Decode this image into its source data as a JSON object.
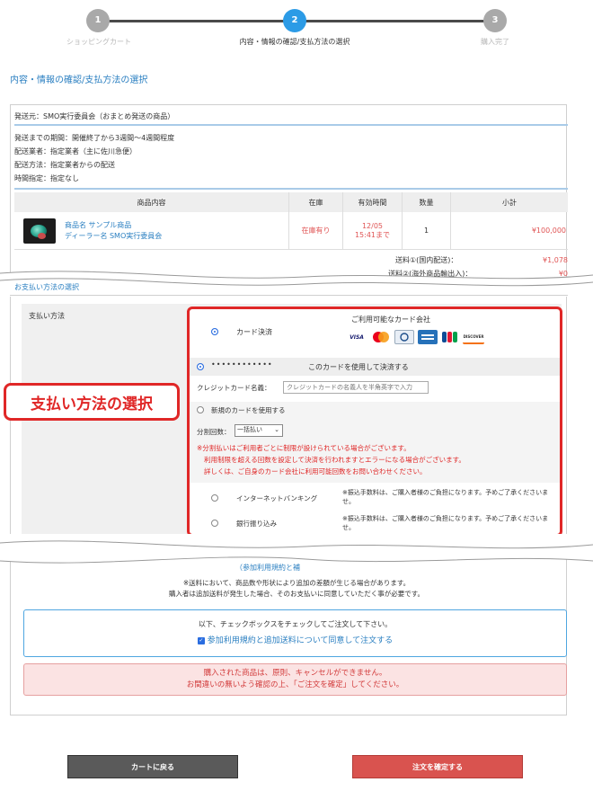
{
  "stepper": {
    "steps": [
      {
        "number": "1",
        "label": "ショッピングカート"
      },
      {
        "number": "2",
        "label": "内容・情報の確認/支払方法の選択"
      },
      {
        "number": "3",
        "label": "購入完了"
      }
    ]
  },
  "page_heading": "内容・情報の確認/支払方法の選択",
  "shipping": {
    "from": "発送元：SMO実行委員会（おまとめ発送の商品）",
    "lines": [
      "発送までの期間：開催終了から3週間〜4週間程度",
      "配送業者：指定業者（主に佐川急便）",
      "配送方法：指定業者からの配送",
      "時間指定：指定なし"
    ]
  },
  "order_table": {
    "headers": [
      "商品内容",
      "在庫",
      "有効時間",
      "数量",
      "小計"
    ],
    "rows": [
      {
        "product_name": "商品名 サンプル商品",
        "dealer_name": "ディーラー名 SMO実行委員会",
        "stock": "在庫有り",
        "valid_date": "12/05",
        "valid_time": "15:41まで",
        "quantity": "1",
        "subtotal": "¥100,000"
      }
    ]
  },
  "shipping_fees": [
    {
      "label": "送料①(国内配送)：",
      "value": "¥1,078"
    },
    {
      "label": "送料②(海外商品輸出入)：",
      "value": "¥0"
    }
  ],
  "payment": {
    "heading": "お支払い方法の選択",
    "label": "支払い方法",
    "card_option": "カード決済",
    "available_cards_title": "ご利用可能なカード会社",
    "card_logos": [
      "VISA",
      "Mastercard",
      "Diners",
      "AMEX",
      "JCB",
      "DISCOVER"
    ],
    "saved_card_number": "••••••••••••",
    "use_saved_card": "このカードを使用して決済する",
    "holder_label": "クレジットカード名義：",
    "holder_placeholder": "クレジットカードの名義人を半角英字で入力",
    "new_card": "新規のカードを使用する",
    "installment_label": "分割回数：",
    "installment_value": "一括払い",
    "installment_notes": [
      "※分割払いはご利用者ごとに制限が設けられている場合がございます。",
      "利用制限を超える回数を設定して決済を行われますとエラーになる場合がございます。",
      "詳しくは、ご自身のカード会社に利用可能回数をお問い合わせください。"
    ],
    "net_banking": "インターネットバンキング",
    "net_banking_note": "※振込手数料は、ご購入者様のご負担になります。予めご了承くださいませ。",
    "bank_transfer": "銀行振り込み",
    "bank_transfer_note": "※振込手数料は、ご購入者様のご負担になります。予めご了承くださいませ。"
  },
  "callout": "支払い方法の選択",
  "terms": {
    "link": "（参加利用規約と補",
    "notes": [
      "※送料において、商品数や形状により追加の差額が生じる場合があります。",
      "購入者は追加送料が発生した場合、そのお支払いに同意していただく事が必要です。"
    ]
  },
  "agree": {
    "instruction": "以下、チェックボックスをチェックしてご注文して下さい。",
    "checkbox_label": "参加利用規約と追加送料について同意して注文する"
  },
  "warning": {
    "line1": "購入された商品は、原則、キャンセルができません。",
    "line2": "お間違いの無いよう確認の上、「ご注文を確定」してください。"
  },
  "buttons": {
    "back": "カートに戻る",
    "confirm": "注文を確定する"
  },
  "colors": {
    "accent_blue": "#2a7fc1",
    "highlight_red": "#e02727",
    "step_active": "#2c9be6",
    "step_inactive": "#a9a9a9"
  }
}
